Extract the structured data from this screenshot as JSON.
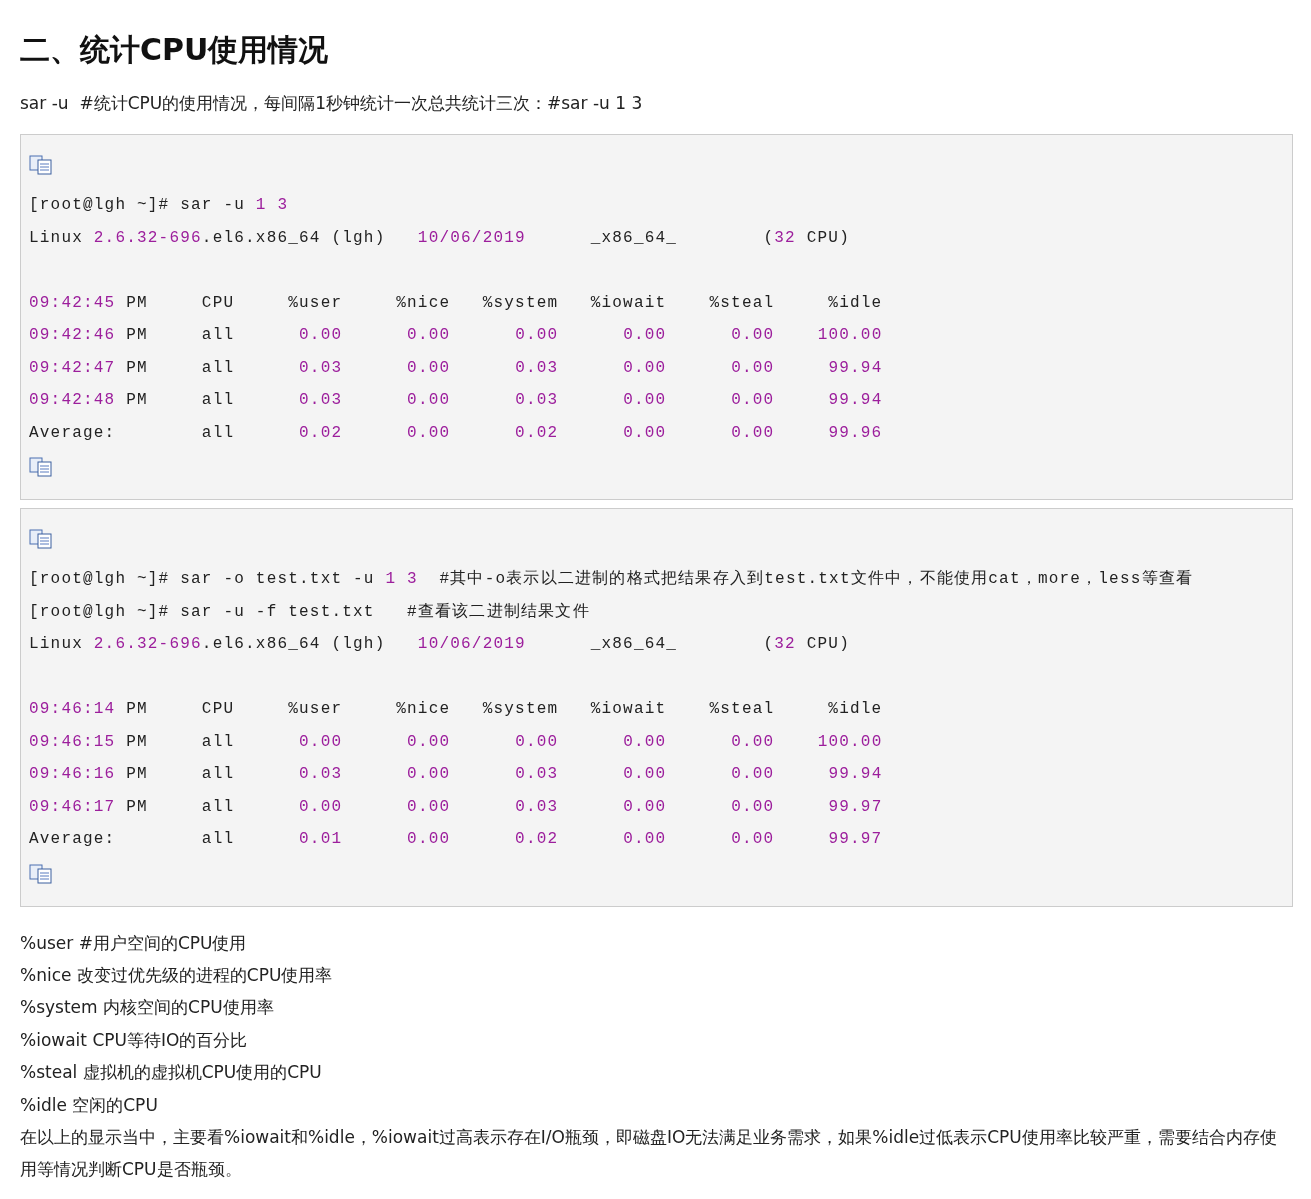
{
  "heading": "二、统计CPU使用情况",
  "intro": "sar -u  #统计CPU的使用情况，每间隔1秒钟统计一次总共统计三次：#sar -u 1 3",
  "code_blocks": [
    {
      "header_lines": [
        "[root@lgh ~]# sar -u 1 3",
        "Linux 2.6.32-696.el6.x86_64 (lgh)   10/06/2019      _x86_64_        (32 CPU)"
      ],
      "table_lines": [
        "09:42:45 PM     CPU     %user     %nice   %system   %iowait    %steal     %idle",
        "09:42:46 PM     all      0.00      0.00      0.00      0.00      0.00    100.00",
        "09:42:47 PM     all      0.03      0.00      0.03      0.00      0.00     99.94",
        "09:42:48 PM     all      0.03      0.00      0.03      0.00      0.00     99.94",
        "Average:        all      0.02      0.00      0.02      0.00      0.00     99.96"
      ]
    },
    {
      "header_lines": [
        "[root@lgh ~]# sar -o test.txt -u 1 3  #其中-o表示以二进制的格式把结果存入到test.txt文件中，不能使用cat，more，less等查看",
        "[root@lgh ~]# sar -u -f test.txt   #查看该二进制结果文件",
        "Linux 2.6.32-696.el6.x86_64 (lgh)   10/06/2019      _x86_64_        (32 CPU)"
      ],
      "table_lines": [
        "09:46:14 PM     CPU     %user     %nice   %system   %iowait    %steal     %idle",
        "09:46:15 PM     all      0.00      0.00      0.00      0.00      0.00    100.00",
        "09:46:16 PM     all      0.03      0.00      0.03      0.00      0.00     99.94",
        "09:46:17 PM     all      0.00      0.00      0.03      0.00      0.00     99.97",
        "Average:        all      0.01      0.00      0.02      0.00      0.00     99.97"
      ]
    }
  ],
  "definitions": [
    "%user #用户空间的CPU使用",
    "%nice 改变过优先级的进程的CPU使用率",
    "%system 内核空间的CPU使用率",
    "%iowait CPU等待IO的百分比",
    "%steal 虚拟机的虚拟机CPU使用的CPU",
    "%idle 空闲的CPU"
  ],
  "conclusion": "在以上的显示当中，主要看%iowait和%idle，%iowait过高表示存在I/O瓶颈，即磁盘IO无法满足业务需求，如果%idle过低表示CPU使用率比较严重，需要结合内存使用等情况判断CPU是否瓶颈。"
}
